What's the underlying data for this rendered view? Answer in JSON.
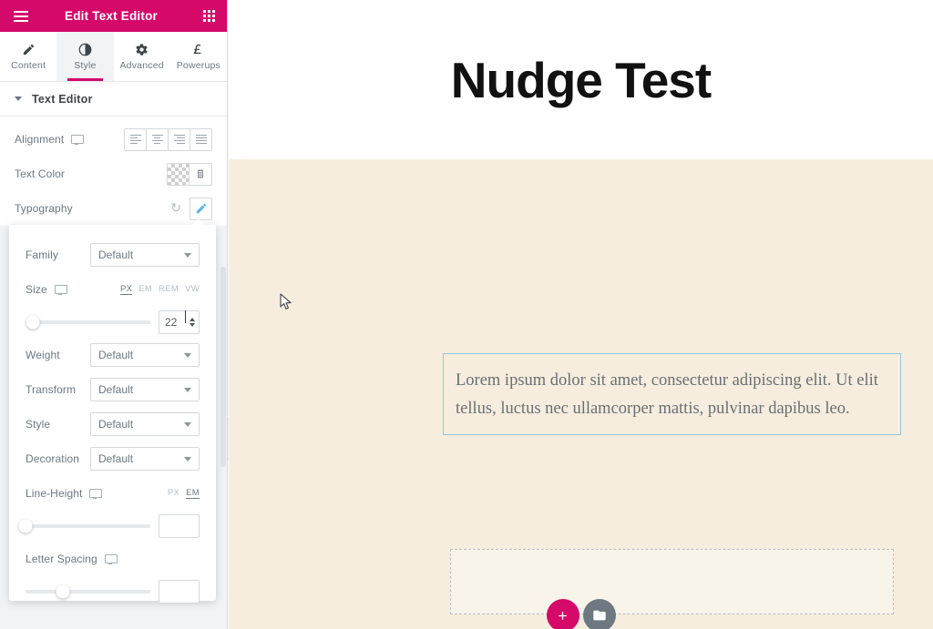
{
  "panel": {
    "header": {
      "title": "Edit Text Editor",
      "menu_icon": "hamburger-icon",
      "widgets_icon": "grid-icon"
    },
    "tabs": [
      {
        "label": "Content",
        "icon": "pencil-icon",
        "active": false
      },
      {
        "label": "Style",
        "icon": "contrast-icon",
        "active": true
      },
      {
        "label": "Advanced",
        "icon": "gear-icon",
        "active": false
      },
      {
        "label": "Powerups",
        "icon": "pound-icon",
        "active": false
      }
    ],
    "section": {
      "title": "Text Editor",
      "caret_icon": "chevron-down-icon"
    },
    "controls": {
      "alignment": {
        "label": "Alignment",
        "device_icon": "desktop-icon",
        "options": [
          "align-left",
          "align-center",
          "align-right",
          "align-justify"
        ]
      },
      "text_color": {
        "label": "Text Color",
        "swatch": "transparent",
        "palette_icon": "palette-icon"
      },
      "typography": {
        "label": "Typography",
        "reset_icon": "reset-icon",
        "edit_icon": "pencil-edit-icon",
        "edit_active": true
      }
    }
  },
  "typography_popover": {
    "family": {
      "label": "Family",
      "value": "Default"
    },
    "size": {
      "label": "Size",
      "device_icon": "desktop-icon",
      "units": [
        "PX",
        "EM",
        "REM",
        "VW"
      ],
      "active_unit": "PX",
      "value": "22",
      "slider_percent": 6
    },
    "weight": {
      "label": "Weight",
      "value": "Default"
    },
    "transform": {
      "label": "Transform",
      "value": "Default"
    },
    "style": {
      "label": "Style",
      "value": "Default"
    },
    "decoration": {
      "label": "Decoration",
      "value": "Default"
    },
    "line_height": {
      "label": "Line-Height",
      "device_icon": "desktop-icon",
      "units": [
        "PX",
        "EM"
      ],
      "active_unit": "EM",
      "value": "",
      "slider_percent": 0
    },
    "letter_spacing": {
      "label": "Letter Spacing",
      "device_icon": "desktop-icon",
      "value": "",
      "slider_percent": 30
    }
  },
  "collapse_tab": {
    "icon": "chevron-left-icon"
  },
  "canvas": {
    "heading": "Nudge Test",
    "text_widget": "Lorem ipsum dolor sit amet, consectetur adipiscing elit. Ut elit tellus, luctus nec ullamcorper mattis, pulvinar dapibus leo.",
    "add_section_button": {
      "label": "+",
      "icon": "plus-icon"
    },
    "add_template_button": {
      "icon": "folder-icon"
    }
  },
  "colors": {
    "brand_pink": "#d5096a",
    "panel_bg": "#f1f3f5",
    "canvas_cream": "#f6edde",
    "widget_outline": "#90c9db",
    "accent_blue": "#59b5e8",
    "label_gray": "#6d7882"
  }
}
